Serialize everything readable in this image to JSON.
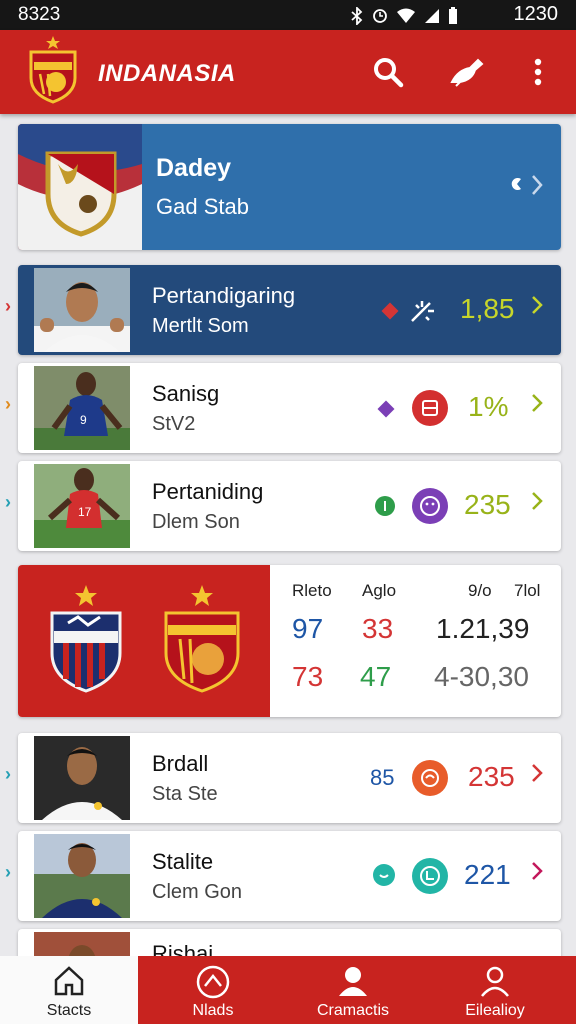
{
  "status_bar": {
    "time_left": "8323",
    "time_right": "1230"
  },
  "app_bar": {
    "title": "INDANASIA"
  },
  "hero": {
    "title": "Dadey",
    "subtitle": "Gad Stab"
  },
  "rows": [
    {
      "name": "Pertandigaring",
      "sub": "Mertlt Som",
      "stat": "1,85",
      "stat_color": "#c7d62a",
      "accent": "#d43535"
    },
    {
      "name": "Sanisg",
      "sub": "StV2",
      "stat": "1%",
      "stat_color": "#98b319",
      "accent": "#e08b1e"
    },
    {
      "name": "Pertaniding",
      "sub": "Dlem Son",
      "stat": "235",
      "stat_color": "#98b319",
      "accent": "#26a0b5"
    },
    {
      "name": "Brdall",
      "sub": "Sta Ste",
      "left_stat": "85",
      "stat": "235",
      "stat_color": "#d43535",
      "accent": "#26a0b5"
    },
    {
      "name": "Stalite",
      "sub": "Clem Gon",
      "stat": "221",
      "stat_color": "#1e56a6",
      "accent": "#26a0b5"
    },
    {
      "name": "Rishai"
    }
  ],
  "score": {
    "headers": [
      "Rleto",
      "Aglo",
      "9/o",
      "7lol"
    ],
    "row1": [
      "97",
      "33",
      "1.21,39"
    ],
    "row2": [
      "73",
      "47",
      "4-30,30"
    ]
  },
  "bottom_nav": [
    {
      "label": "Stacts",
      "icon": "home-icon"
    },
    {
      "label": "Nlads",
      "icon": "chevron-badge-icon"
    },
    {
      "label": "Cramactis",
      "icon": "person-icon"
    },
    {
      "label": "Eilealioy",
      "icon": "person-outline-icon"
    }
  ]
}
